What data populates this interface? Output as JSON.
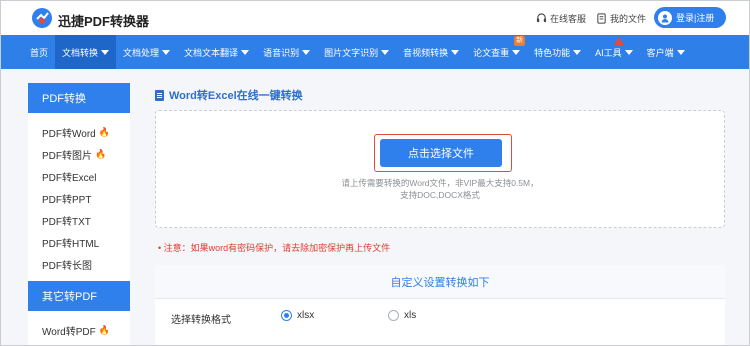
{
  "header": {
    "brand": "迅捷PDF转换器",
    "online_service": "在线客服",
    "my_files": "我的文件",
    "login": "登录|注册"
  },
  "nav": {
    "items": [
      {
        "label": "首页",
        "caret": false
      },
      {
        "label": "文档转换",
        "caret": true,
        "active": true
      },
      {
        "label": "文档处理",
        "caret": true
      },
      {
        "label": "文档文本翻译",
        "caret": true
      },
      {
        "label": "语音识别",
        "caret": true
      },
      {
        "label": "图片文字识别",
        "caret": true
      },
      {
        "label": "音视频转换",
        "caret": true
      },
      {
        "label": "论文查重",
        "caret": true,
        "badge": "新"
      },
      {
        "label": "特色功能",
        "caret": true
      },
      {
        "label": "AI工具",
        "caret": true,
        "marker": true
      },
      {
        "label": "客户端",
        "caret": true
      }
    ]
  },
  "sidebar": {
    "section1_title": "PDF转换",
    "section1_items": [
      {
        "label": "PDF转Word",
        "hot": true
      },
      {
        "label": "PDF转图片",
        "hot": true
      },
      {
        "label": "PDF转Excel",
        "hot": false
      },
      {
        "label": "PDF转PPT",
        "hot": false
      },
      {
        "label": "PDF转TXT",
        "hot": false
      },
      {
        "label": "PDF转HTML",
        "hot": false
      },
      {
        "label": "PDF转长图",
        "hot": false
      }
    ],
    "section2_title": "其它转PDF",
    "section2_items": [
      {
        "label": "Word转PDF",
        "hot": true
      }
    ]
  },
  "main": {
    "title": "Word转Excel在线一键转换",
    "select_button": "点击选择文件",
    "hint_line1": "请上传需要转换的Word文件，非VIP最大支持0.5M，",
    "hint_line2": "支持DOC,DOCX格式",
    "notice": "注意：如果word有密码保护，请去除加密保护再上传文件",
    "settings_title": "自定义设置转换如下",
    "format_label": "选择转换格式",
    "format_options": [
      {
        "label": "xlsx",
        "checked": true
      },
      {
        "label": "xls",
        "checked": false
      }
    ]
  },
  "colors": {
    "accent": "#2f80ed",
    "nav_bg": "#2f7fe8",
    "warning": "#e03c2f"
  }
}
